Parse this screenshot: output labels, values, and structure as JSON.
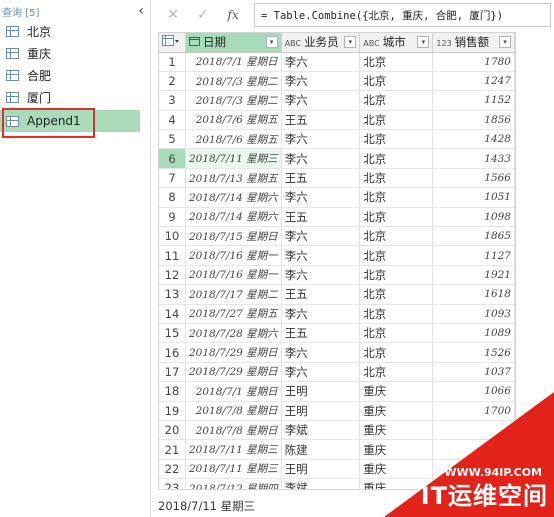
{
  "queries_pane": {
    "title": "查询 [5]",
    "collapse_icon": "chevron-left-icon",
    "items": [
      {
        "label": "北京",
        "icon": "table-icon"
      },
      {
        "label": "重庆",
        "icon": "table-icon"
      },
      {
        "label": "合肥",
        "icon": "table-icon"
      },
      {
        "label": "厦门",
        "icon": "table-icon"
      },
      {
        "label": "Append1",
        "icon": "table-icon",
        "selected": true
      }
    ],
    "highlight_color": "#e0302c",
    "selected_color": "#a8dcb9"
  },
  "formula_bar": {
    "cancel_icon": "✕",
    "confirm_icon": "✓",
    "fx_label": "fx",
    "formula": "= Table.Combine({北京, 重庆, 合肥, 厦门})"
  },
  "grid": {
    "columns": [
      {
        "type": "",
        "name": "日期",
        "filter": "▾"
      },
      {
        "type": "ABC",
        "name": "业务员",
        "filter": "▾"
      },
      {
        "type": "ABC",
        "name": "城市",
        "filter": "▾"
      },
      {
        "type": "123",
        "name": "销售额",
        "filter": "▾"
      }
    ],
    "selected_row": 6,
    "rows": [
      {
        "n": "1",
        "date": "2018/7/1 星期日",
        "rep": "李六",
        "city": "北京",
        "sales": "1780"
      },
      {
        "n": "2",
        "date": "2018/7/3 星期二",
        "rep": "李六",
        "city": "北京",
        "sales": "1247"
      },
      {
        "n": "3",
        "date": "2018/7/3 星期二",
        "rep": "李六",
        "city": "北京",
        "sales": "1152"
      },
      {
        "n": "4",
        "date": "2018/7/6 星期五",
        "rep": "王五",
        "city": "北京",
        "sales": "1856"
      },
      {
        "n": "5",
        "date": "2018/7/6 星期五",
        "rep": "李六",
        "city": "北京",
        "sales": "1428"
      },
      {
        "n": "6",
        "date": "2018/7/11 星期三",
        "rep": "李六",
        "city": "北京",
        "sales": "1433"
      },
      {
        "n": "7",
        "date": "2018/7/13 星期五",
        "rep": "王五",
        "city": "北京",
        "sales": "1566"
      },
      {
        "n": "8",
        "date": "2018/7/14 星期六",
        "rep": "李六",
        "city": "北京",
        "sales": "1051"
      },
      {
        "n": "9",
        "date": "2018/7/14 星期六",
        "rep": "王五",
        "city": "北京",
        "sales": "1098"
      },
      {
        "n": "10",
        "date": "2018/7/15 星期日",
        "rep": "李六",
        "city": "北京",
        "sales": "1865"
      },
      {
        "n": "11",
        "date": "2018/7/16 星期一",
        "rep": "李六",
        "city": "北京",
        "sales": "1127"
      },
      {
        "n": "12",
        "date": "2018/7/16 星期一",
        "rep": "李六",
        "city": "北京",
        "sales": "1921"
      },
      {
        "n": "13",
        "date": "2018/7/17 星期二",
        "rep": "王五",
        "city": "北京",
        "sales": "1618"
      },
      {
        "n": "14",
        "date": "2018/7/27 星期五",
        "rep": "李六",
        "city": "北京",
        "sales": "1093"
      },
      {
        "n": "15",
        "date": "2018/7/28 星期六",
        "rep": "王五",
        "city": "北京",
        "sales": "1089"
      },
      {
        "n": "16",
        "date": "2018/7/29 星期日",
        "rep": "李六",
        "city": "北京",
        "sales": "1526"
      },
      {
        "n": "17",
        "date": "2018/7/29 星期日",
        "rep": "李六",
        "city": "北京",
        "sales": "1037"
      },
      {
        "n": "18",
        "date": "2018/7/1 星期日",
        "rep": "王明",
        "city": "重庆",
        "sales": "1066"
      },
      {
        "n": "19",
        "date": "2018/7/8 星期日",
        "rep": "王明",
        "city": "重庆",
        "sales": "1700"
      },
      {
        "n": "20",
        "date": "2018/7/8 星期日",
        "rep": "李斌",
        "city": "重庆",
        "sales": ""
      },
      {
        "n": "21",
        "date": "2018/7/11 星期三",
        "rep": "陈建",
        "city": "重庆",
        "sales": ""
      },
      {
        "n": "22",
        "date": "2018/7/11 星期三",
        "rep": "王明",
        "city": "重庆",
        "sales": ""
      },
      {
        "n": "23",
        "date": "2018/7/12 星期四",
        "rep": "李斌",
        "city": "重庆",
        "sales": ""
      }
    ]
  },
  "status_bar": {
    "text": "2018/7/11 星期三"
  },
  "watermark": {
    "url": "WWW.94IP.COM",
    "name": "IT运维空间",
    "color": "#e2231a"
  }
}
